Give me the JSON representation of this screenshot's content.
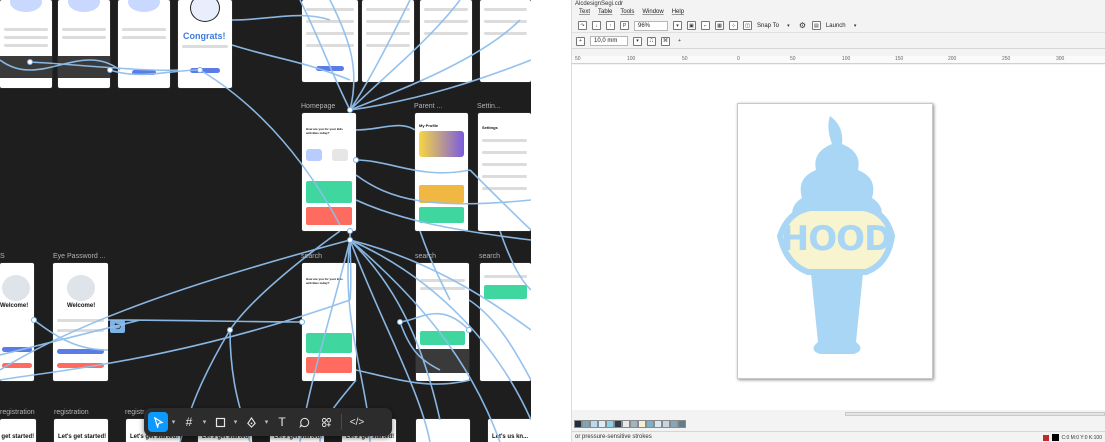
{
  "figma": {
    "frame_labels": {
      "homepage": "Homepage",
      "parent": "Parent ...",
      "settings": "Settin...",
      "eye_password": "Eye Password ...",
      "s_left": "S",
      "search1": "search",
      "search2": "search",
      "search3": "search",
      "registration1": "registration",
      "registration2": "registration",
      "registration3": "registr..."
    },
    "screens": {
      "congrats_title": "Congrats!",
      "welcome_title": "Welcome!",
      "welcome_title_left": "Welcome!",
      "lets_get_started": "Let's get started!",
      "lets_us_know": "Let's us kn...",
      "homepage_question": "How are you for your kids activities today?",
      "settings_title": "Settings",
      "my_profile": "My Profile"
    },
    "toolbar": {
      "move_tool": "move-tool",
      "frame_tool": "frame-tool",
      "shape_tool": "shape-tool",
      "pen_tool": "pen-tool",
      "text_tool": "T",
      "comment_tool": "comment-tool",
      "components_tool": "components-tool",
      "dev_mode": "</>"
    }
  },
  "corel": {
    "title": "AlcdesignSegi.cdr",
    "menu": [
      "Text",
      "Table",
      "Tools",
      "Window",
      "Help"
    ],
    "toolbar1": {
      "zoom": "96%",
      "snap": "Snap To",
      "launch": "Launch"
    },
    "toolbar2": {
      "outline_width": "10,0 mm"
    },
    "ruler_ticks": [
      "50",
      "100",
      "50",
      "0",
      "50",
      "100",
      "150",
      "200",
      "250",
      "300"
    ],
    "artwork_text": "HOOD",
    "status_left": "or pressure-sensitive strokes",
    "status_color": "C:0 M:0 Y:0 K:100",
    "palette": [
      "#1f2d3d",
      "#7fa3b8",
      "#b9d9ee",
      "#d9eef9",
      "#8ccfe6",
      "#2f3b48",
      "#e8e8e8",
      "#9fb5c2",
      "#f3f0d4",
      "#7ab0c9",
      "#d9e6ed",
      "#c2d7e3",
      "#88a8b8",
      "#5f7f8e"
    ]
  }
}
